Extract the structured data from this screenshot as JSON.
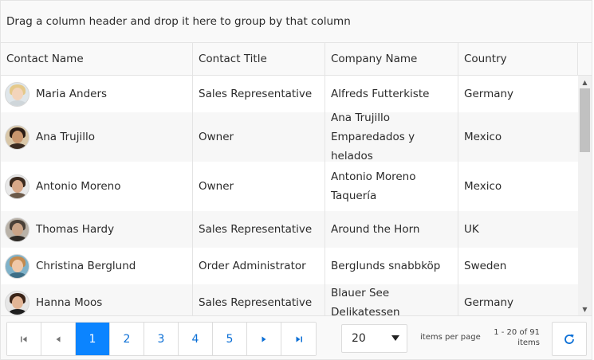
{
  "group_panel": {
    "text": "Drag a column header and drop it here to group by that column"
  },
  "columns": [
    "Contact Name",
    "Contact Title",
    "Company Name",
    "Country"
  ],
  "rows": [
    {
      "contact": "Maria Anders",
      "title": "Sales Representative",
      "company": "Alfreds Futterkiste",
      "country": "Germany"
    },
    {
      "contact": "Ana Trujillo",
      "title": "Owner",
      "company": "Ana Trujillo Emparedados y helados",
      "country": "Mexico"
    },
    {
      "contact": "Antonio Moreno",
      "title": "Owner",
      "company": "Antonio Moreno Taquería",
      "country": "Mexico"
    },
    {
      "contact": "Thomas Hardy",
      "title": "Sales Representative",
      "company": "Around the Horn",
      "country": "UK"
    },
    {
      "contact": "Christina Berglund",
      "title": "Order Administrator",
      "company": "Berglunds snabbköp",
      "country": "Sweden"
    },
    {
      "contact": "Hanna Moos",
      "title": "Sales Representative",
      "company": "Blauer See Delikatessen",
      "country": "Germany"
    }
  ],
  "pager": {
    "pages": [
      "1",
      "2",
      "3",
      "4",
      "5"
    ],
    "current_page": "1",
    "page_size": "20",
    "items_per_page_label": "items per page",
    "info_line1": "1 - 20 of 91",
    "info_line2": "items"
  },
  "icons": {
    "first": "first-page-icon",
    "prev": "prev-page-icon",
    "next": "next-page-icon",
    "last": "last-page-icon",
    "refresh": "refresh-icon"
  },
  "colors": {
    "accent": "#0b84ff",
    "link": "#0b6fd6",
    "alt_row": "#f7f7f7",
    "header_bg": "#f9f9f9"
  }
}
